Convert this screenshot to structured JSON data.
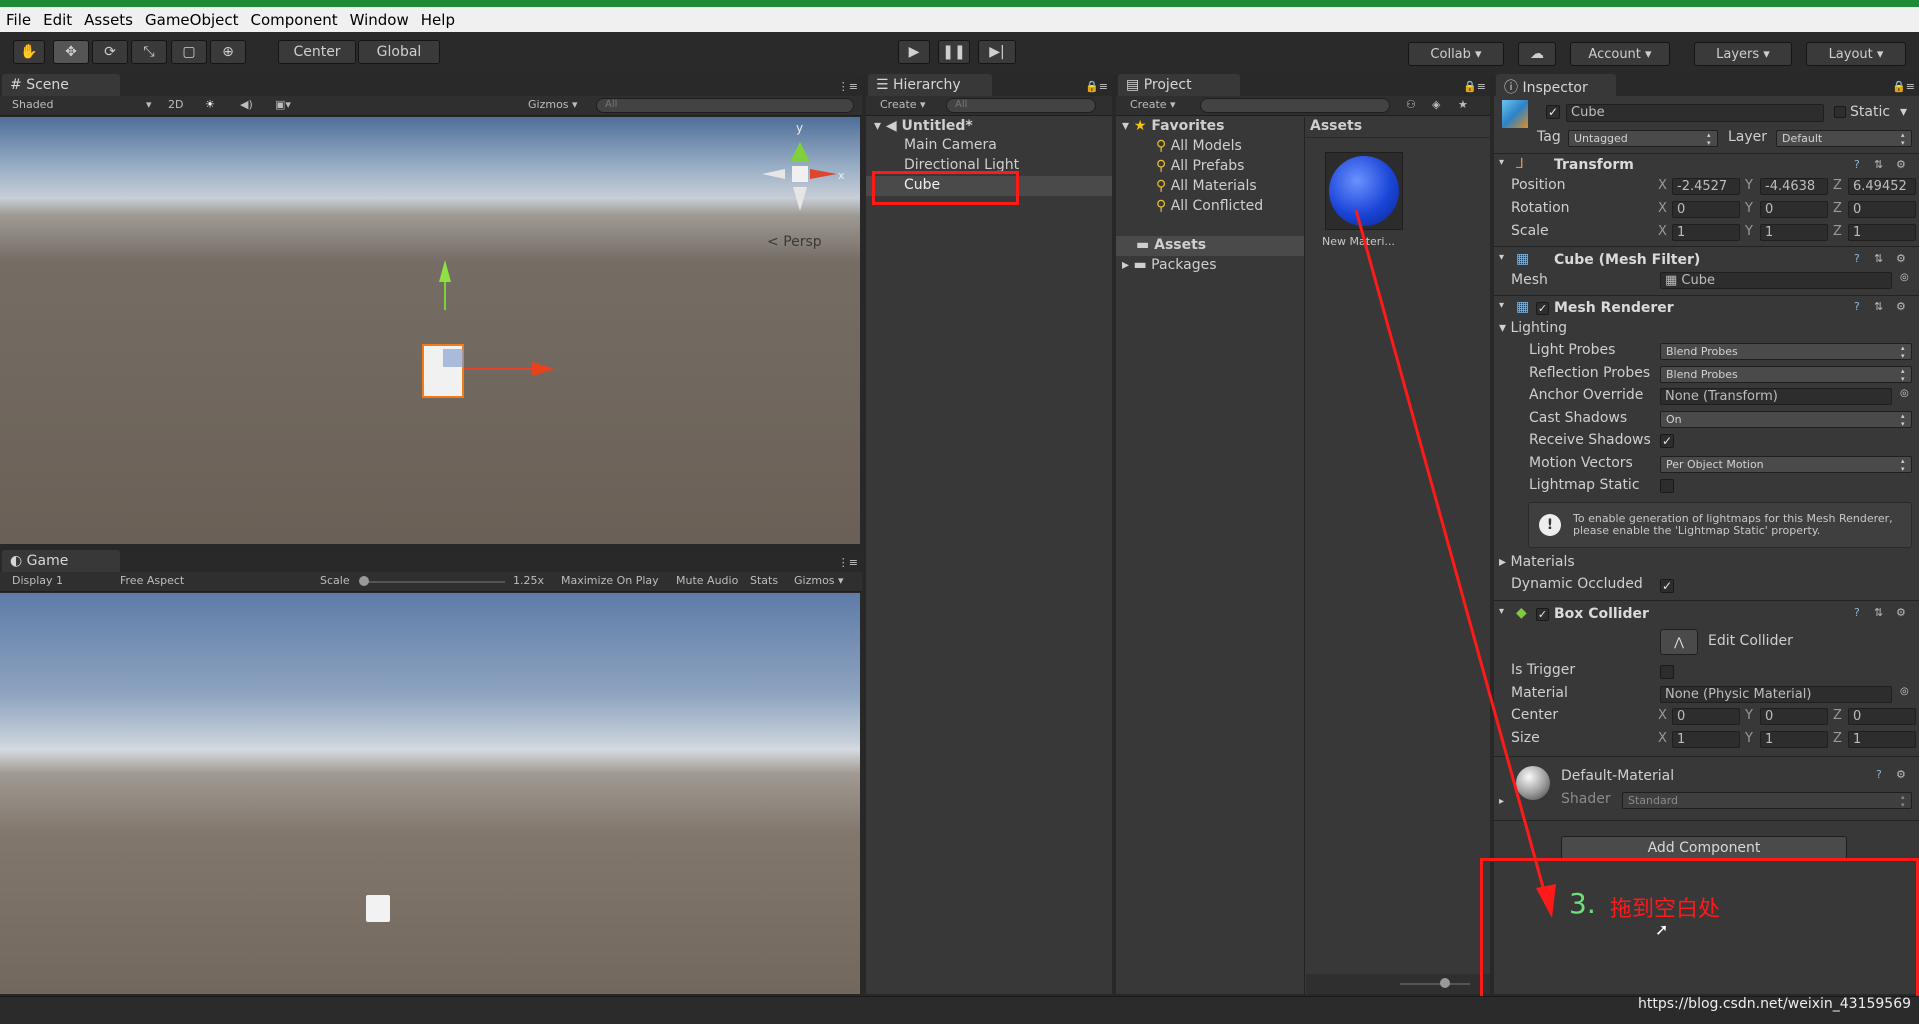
{
  "menu": [
    "File",
    "Edit",
    "Assets",
    "GameObject",
    "Component",
    "Window",
    "Help"
  ],
  "toolbar": {
    "center": "Center",
    "global": "Global",
    "collab": "Collab",
    "account": "Account",
    "layers": "Layers",
    "layout": "Layout"
  },
  "scene": {
    "tab": "Scene",
    "shading": "Shaded",
    "mode2d": "2D",
    "gizmos": "Gizmos",
    "search": "All",
    "persp": "Persp",
    "axis_y": "y",
    "axis_x": "x"
  },
  "game": {
    "tab": "Game",
    "display": "Display 1",
    "aspect": "Free Aspect",
    "scale_label": "Scale",
    "scale_value": "1.25x",
    "maximize": "Maximize On Play",
    "mute": "Mute Audio",
    "stats": "Stats",
    "gizmos": "Gizmos"
  },
  "hierarchy": {
    "tab": "Hierarchy",
    "create": "Create",
    "search": "All",
    "scene_name": "Untitled*",
    "items": [
      "Main Camera",
      "Directional Light",
      "Cube"
    ]
  },
  "project": {
    "tab": "Project",
    "create": "Create",
    "favorites": "Favorites",
    "fav_items": [
      "All Models",
      "All Prefabs",
      "All Materials",
      "All Conflicted"
    ],
    "folders": [
      "Assets",
      "Packages"
    ],
    "assets_header": "Assets",
    "asset_name": "New Materi..."
  },
  "inspector": {
    "tab": "Inspector",
    "object_name": "Cube",
    "static": "Static",
    "tag_label": "Tag",
    "tag_value": "Untagged",
    "layer_label": "Layer",
    "layer_value": "Default",
    "transform": {
      "title": "Transform",
      "position": "Position",
      "rotation": "Rotation",
      "scale": "Scale",
      "pos": [
        "-2.4527",
        "-4.4638",
        "6.49452"
      ],
      "rot": [
        "0",
        "0",
        "0"
      ],
      "scl": [
        "1",
        "1",
        "1"
      ]
    },
    "axes": {
      "x": "X",
      "y": "Y",
      "z": "Z"
    },
    "mesh_filter": {
      "title": "Cube (Mesh Filter)",
      "mesh_label": "Mesh",
      "mesh_value": "Cube"
    },
    "mesh_renderer": {
      "title": "Mesh Renderer",
      "lighting": "Lighting",
      "light_probes": "Light Probes",
      "light_probes_v": "Blend Probes",
      "reflection_probes": "Reflection Probes",
      "reflection_probes_v": "Blend Probes",
      "anchor": "Anchor Override",
      "anchor_v": "None (Transform)",
      "cast": "Cast Shadows",
      "cast_v": "On",
      "receive": "Receive Shadows",
      "motion": "Motion Vectors",
      "motion_v": "Per Object Motion",
      "lightmap": "Lightmap Static",
      "info": "To enable generation of lightmaps for this Mesh Renderer, please enable the 'Lightmap Static' property.",
      "materials": "Materials",
      "dynamic": "Dynamic Occluded"
    },
    "box_collider": {
      "title": "Box Collider",
      "edit": "Edit Collider",
      "trigger": "Is Trigger",
      "material": "Material",
      "material_v": "None (Physic Material)",
      "center": "Center",
      "size": "Size",
      "center_v": [
        "0",
        "0",
        "0"
      ],
      "size_v": [
        "1",
        "1",
        "1"
      ]
    },
    "material": {
      "name": "Default-Material",
      "shader_label": "Shader",
      "shader_value": "Standard"
    },
    "add_component": "Add Component"
  },
  "annotation": {
    "step": "3.",
    "text": "拖到空白处",
    "color": "#ff1a1a",
    "step_color": "#6ee07a"
  },
  "watermark": "https://blog.csdn.net/weixin_43159569"
}
